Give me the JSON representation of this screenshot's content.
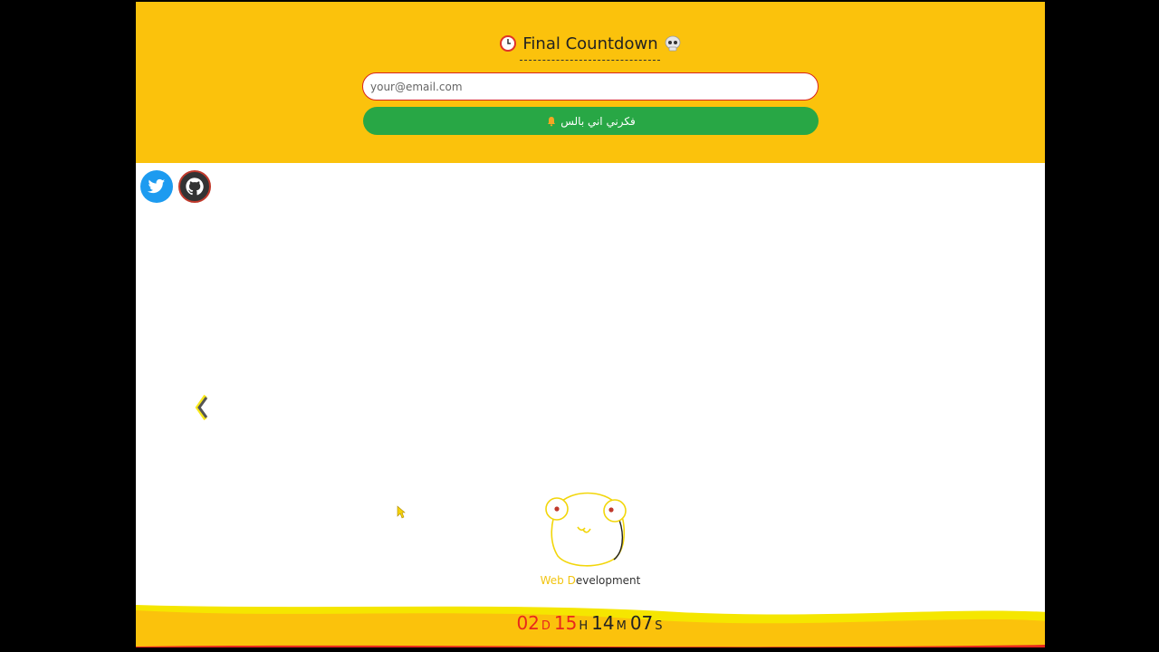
{
  "header": {
    "title": "Final Countdown",
    "clock_icon": "clock-icon",
    "skull_icon": "skull-icon"
  },
  "signup": {
    "email_placeholder": "your@email.com",
    "notify_label": "فكرني اني بالس",
    "notify_icon": "bell-icon"
  },
  "social": {
    "twitter_icon": "twitter-icon",
    "github_icon": "github-icon"
  },
  "carousel": {
    "prev_icon": "chevron-left-icon"
  },
  "mascot": {
    "caption_first": "Web D",
    "caption_rest": "evelopment"
  },
  "countdown": {
    "days": "02",
    "days_unit": "D",
    "hours": "15",
    "hours_unit": "H",
    "minutes": "14",
    "minutes_unit": "M",
    "seconds": "07",
    "seconds_unit": "S"
  },
  "colors": {
    "hero_bg": "#fbc20c",
    "button_green": "#28a745",
    "twitter_blue": "#1d9bf0",
    "countdown_red": "#e8271c"
  }
}
